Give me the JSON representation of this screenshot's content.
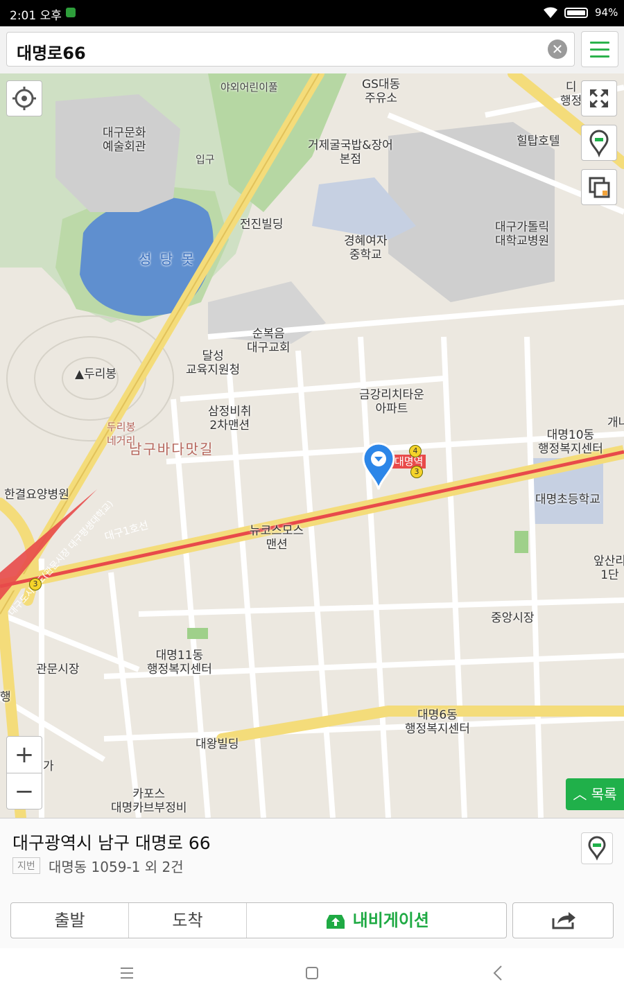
{
  "status_bar": {
    "time": "2:01 오후",
    "battery": "94%"
  },
  "search": {
    "query": "대명로66"
  },
  "map": {
    "labels": {
      "pool": "야외어린이풀",
      "gas": "GS대동\n주유소",
      "hotel": "힐탑호텔",
      "top_right": "디\n행정",
      "arts": "대구문화\n예술회관",
      "entrance": "입구",
      "restaurant": "거제굴국밥&장어\n본점",
      "jeonjin": "전진빌딩",
      "school_gh": "경혜여자\n중학교",
      "hospital_catholic": "대구가톨릭\n대학교병원",
      "lake": "성 당 못",
      "church": "순복음\n대구교회",
      "dalseong": "달성\n교육지원청",
      "duribong": "▲두리봉",
      "geumgang": "금강리치타운\n아파트",
      "samjeong": "삼정비취\n2차맨션",
      "duri_junction": "두리봉\n네거리",
      "sea_street": "남구바다맛길",
      "daemyeong10": "대명10동\n행정복지센터",
      "gae": "개나",
      "station": "대명역",
      "hangyeol": "한결요양병원",
      "elem": "대명초등학교",
      "newcosmos": "뉴코스모스\n맨션",
      "line1": "대구1호선",
      "apsan": "앞산리\n1단",
      "central_market": "중앙시장",
      "daemyeong11": "대명11동\n행정복지센터",
      "gwanmun": "관문시장",
      "daemyeong6": "대명6동\n행정복지센터",
      "daewang": "대왕빌딩",
      "left_edge": "행",
      "ga": "가",
      "carpos": "카포스\n대명카브부정비",
      "diag_line": "대구도시철도(관문시장 대구평생대학교)"
    }
  },
  "buttons": {
    "zoom_in": "+",
    "zoom_out": "−",
    "list": "목록"
  },
  "place": {
    "address": "대구광역시 남구 대명로 66",
    "jibun_tag": "지번",
    "jibun": "대명동 1059-1 외 2건"
  },
  "actions": {
    "start": "출발",
    "arrive": "도착",
    "navigation": "내비게이션"
  },
  "colors": {
    "accent": "#20b04a",
    "route": "#e84a4a"
  }
}
